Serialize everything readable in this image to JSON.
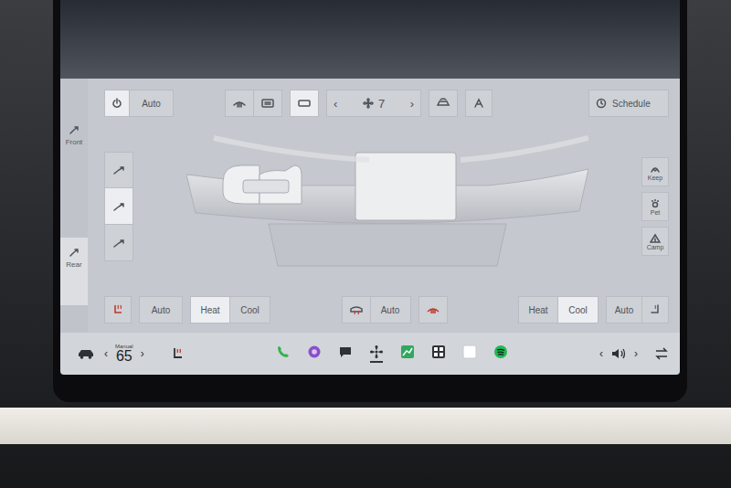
{
  "zones": [
    {
      "label": "Front",
      "selected": false
    },
    {
      "label": "Rear",
      "selected": true
    }
  ],
  "top_bar": {
    "power": {
      "on": true
    },
    "auto": "Auto",
    "vent_buttons": [
      {
        "selected": false
      },
      {
        "selected": false
      },
      {
        "selected": true
      }
    ],
    "fan": {
      "prev": "‹",
      "speed": "7",
      "next": "›"
    },
    "schedule": "Schedule"
  },
  "airflow": [
    {
      "selected": false
    },
    {
      "selected": true
    },
    {
      "selected": false
    }
  ],
  "modes": [
    {
      "label": "Keep",
      "kind": "keep"
    },
    {
      "label": "Pet",
      "kind": "pet"
    },
    {
      "label": "Camp",
      "kind": "camp"
    }
  ],
  "bottom": {
    "left": {
      "auto": "Auto",
      "options": [
        {
          "label": "Heat",
          "selected": true
        },
        {
          "label": "Cool",
          "selected": false
        }
      ]
    },
    "center": {
      "auto": "Auto"
    },
    "right": {
      "auto": "Auto",
      "options": [
        {
          "label": "Heat",
          "selected": false
        },
        {
          "label": "Cool",
          "selected": true
        }
      ]
    }
  },
  "dock": {
    "temp": {
      "prev": "‹",
      "mode": "Manual",
      "value": "65",
      "next": "›"
    },
    "apps": [
      {
        "kind": "phone",
        "selected": false
      },
      {
        "kind": "camera",
        "selected": false
      },
      {
        "kind": "messages",
        "selected": false
      },
      {
        "kind": "fan",
        "selected": true
      },
      {
        "kind": "chart",
        "selected": false
      },
      {
        "kind": "grid",
        "selected": false
      },
      {
        "kind": "square",
        "selected": false
      },
      {
        "kind": "spotify",
        "selected": false
      }
    ],
    "volume": {
      "prev": "‹",
      "next": "›"
    }
  }
}
